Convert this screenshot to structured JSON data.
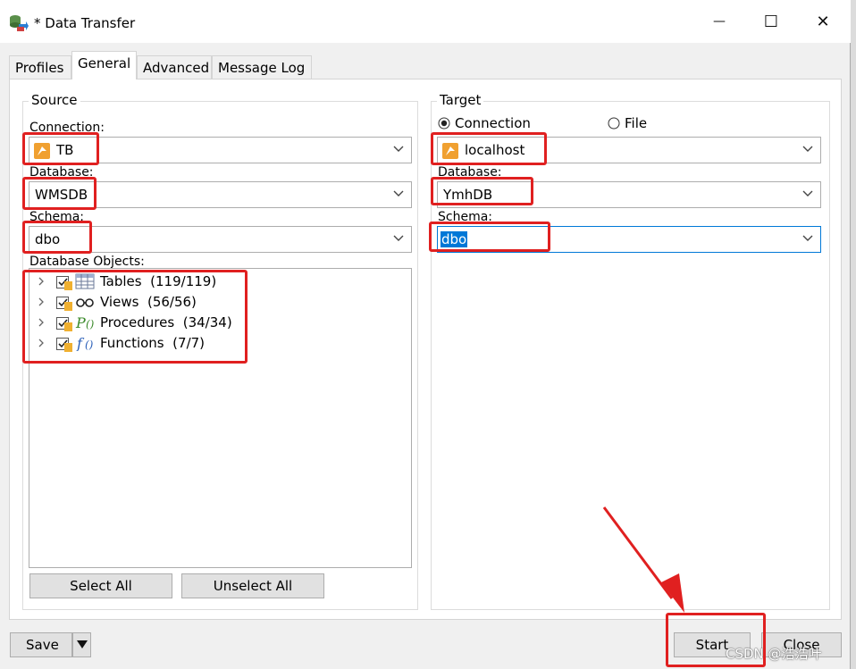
{
  "window": {
    "title": "* Data Transfer"
  },
  "window_controls": {
    "minimize": "—",
    "maximize": "☐",
    "close": "✕"
  },
  "tabs": [
    {
      "label": "Profiles"
    },
    {
      "label": "General"
    },
    {
      "label": "Advanced"
    },
    {
      "label": "Message Log"
    }
  ],
  "source": {
    "legend": "Source",
    "connection_label": "Connection:",
    "connection_value": "TB",
    "database_label": "Database:",
    "database_value": "WMSDB",
    "schema_label": "Schema:",
    "schema_value": "dbo",
    "objects_label": "Database Objects:",
    "objects": [
      {
        "label": "Tables",
        "count": "(119/119)",
        "icon": "table-icon"
      },
      {
        "label": "Views",
        "count": "(56/56)",
        "icon": "view-glasses-icon"
      },
      {
        "label": "Procedures",
        "count": "(34/34)",
        "icon": "procedure-icon"
      },
      {
        "label": "Functions",
        "count": "(7/7)",
        "icon": "function-icon"
      }
    ],
    "select_all": "Select All",
    "unselect_all": "Unselect All"
  },
  "target": {
    "legend": "Target",
    "radio_connection": "Connection",
    "radio_file": "File",
    "connection_value": "localhost",
    "database_label": "Database:",
    "database_value": "YmhDB",
    "schema_label": "Schema:",
    "schema_value": "dbo"
  },
  "footer": {
    "save": "Save",
    "start": "Start",
    "close": "Close",
    "watermark": "CSDN @浩浩叶"
  },
  "colors": {
    "highlight_red": "#e02020",
    "selection_blue": "#0078d7"
  }
}
